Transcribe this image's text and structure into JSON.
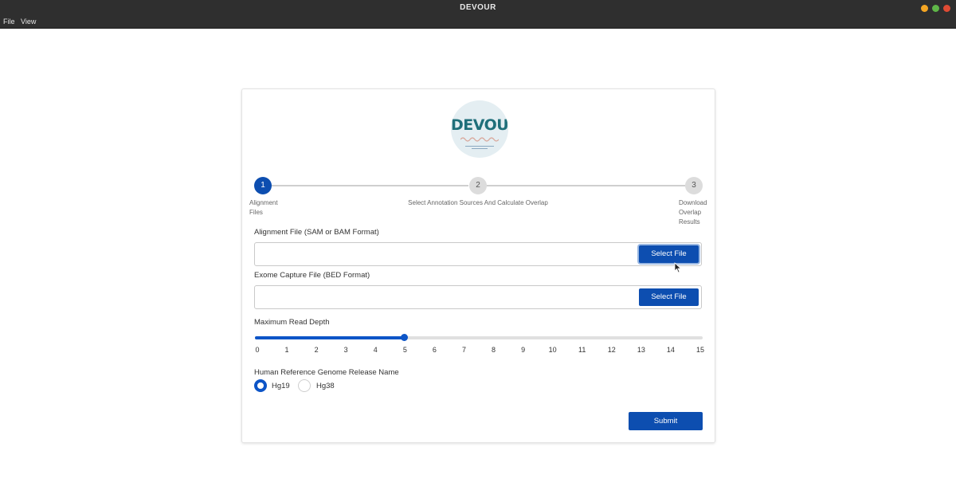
{
  "window": {
    "title": "DEVOUR"
  },
  "menu": {
    "items": [
      "File",
      "View"
    ]
  },
  "logo": {
    "text": "DEVOUR"
  },
  "stepper": {
    "steps": [
      {
        "number": "1",
        "label": "Alignment Files",
        "active": true
      },
      {
        "number": "2",
        "label": "Select Annotation Sources And Calculate Overlap",
        "active": false
      },
      {
        "number": "3",
        "label": "Download Overlap Results",
        "active": false
      }
    ]
  },
  "alignment_file": {
    "label": "Alignment File (SAM or BAM Format)",
    "value": "",
    "button": "Select File"
  },
  "exome_file": {
    "label": "Exome Capture File (BED Format)",
    "value": "",
    "button": "Select File"
  },
  "read_depth": {
    "label": "Maximum Read Depth",
    "min": 0,
    "max": 15,
    "value": 5,
    "ticks": [
      "0",
      "1",
      "2",
      "3",
      "4",
      "5",
      "6",
      "7",
      "8",
      "9",
      "10",
      "11",
      "12",
      "13",
      "14",
      "15"
    ]
  },
  "genome": {
    "label": "Human Reference Genome Release Name",
    "options": [
      {
        "label": "Hg19",
        "checked": true
      },
      {
        "label": "Hg38",
        "checked": false
      }
    ]
  },
  "submit": {
    "label": "Submit"
  },
  "colors": {
    "primary": "#0d4eb0",
    "titlebar": "#2f2f2f",
    "inactive_step": "#dcdcdc"
  }
}
